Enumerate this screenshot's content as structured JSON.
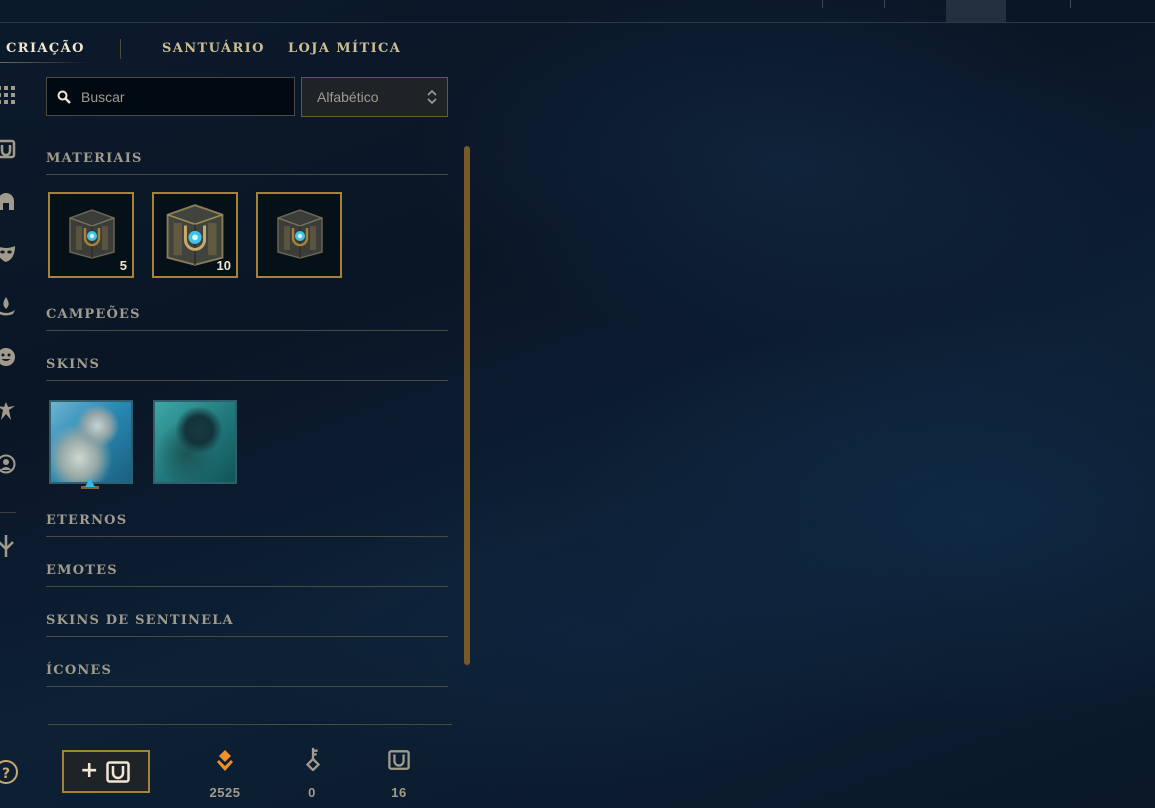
{
  "tabs": [
    {
      "label": "CRIAÇÃO",
      "active": true
    },
    {
      "label": "SANTUÁRIO",
      "active": false
    },
    {
      "label": "LOJA MÍTICA",
      "active": false
    }
  ],
  "rail_icons": [
    "grid-icon",
    "chest-icon",
    "helmet-icon",
    "mask-icon",
    "ward-icon",
    "emote-icon",
    "eternals-icon",
    "profile-icon",
    "key-icon"
  ],
  "search": {
    "placeholder": "Buscar",
    "value": ""
  },
  "sort": {
    "selected": "Alfabético"
  },
  "sections": {
    "materials": {
      "title": "MATERIAIS",
      "items": [
        {
          "icon": "hextech-chest-icon",
          "count": "5"
        },
        {
          "icon": "masterwork-chest-icon",
          "count": "10"
        },
        {
          "icon": "hextech-chest-icon",
          "count": ""
        }
      ]
    },
    "champions": {
      "title": "CAMPEÕES"
    },
    "skins": {
      "title": "SKINS",
      "count": 2
    },
    "eternals": {
      "title": "ETERNOS"
    },
    "emotes": {
      "title": "EMOTES"
    },
    "ward_skins": {
      "title": "SKINS DE SENTINELA"
    },
    "icons": {
      "title": "ÍCONES"
    }
  },
  "bottom": {
    "currencies": [
      {
        "icon": "orange-essence-icon",
        "value": "2525"
      },
      {
        "icon": "key-fragment-icon",
        "value": "0"
      },
      {
        "icon": "chest-icon",
        "value": "16"
      }
    ]
  },
  "colors": {
    "gold": "#c8aa6e",
    "gold_dark": "#785a28",
    "text_light": "#f0e6d2",
    "text_muted": "#a09b8c",
    "background": "#0a1626"
  }
}
